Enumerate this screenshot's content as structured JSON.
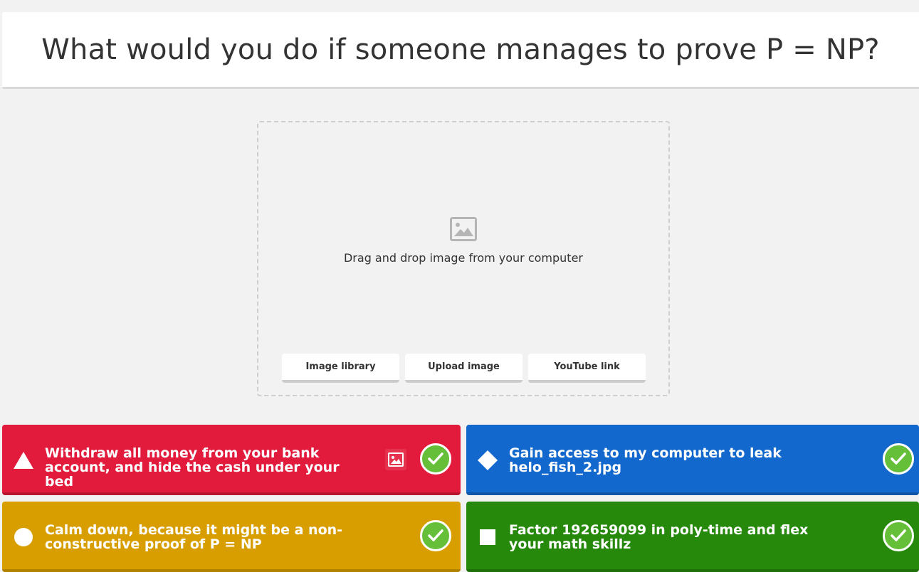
{
  "question": {
    "title": "What would you do if someone manages to prove P = NP?"
  },
  "media": {
    "icon": "image-placeholder-icon",
    "hint": "Drag and drop image from your computer",
    "buttons": [
      {
        "label": "Image library"
      },
      {
        "label": "Upload image"
      },
      {
        "label": "YouTube link"
      }
    ]
  },
  "answers": [
    {
      "shape": "triangle-icon",
      "text": "Withdraw all money from your bank account, and hide the cash under your bed",
      "color": "#e21b3c",
      "correct": true,
      "has_image_button": true
    },
    {
      "shape": "diamond-icon",
      "text": "Gain access to my computer to leak helo_fish_2.jpg",
      "color": "#1368ce",
      "correct": true,
      "has_image_button": false
    },
    {
      "shape": "circle-icon",
      "text": "Calm down, because it might be a non-constructive proof of P = NP",
      "color": "#d89e00",
      "correct": true,
      "has_image_button": false
    },
    {
      "shape": "square-icon",
      "text": "Factor 192659099 in poly-time and flex your math skillz",
      "color": "#26890c",
      "correct": true,
      "has_image_button": false
    }
  ]
}
